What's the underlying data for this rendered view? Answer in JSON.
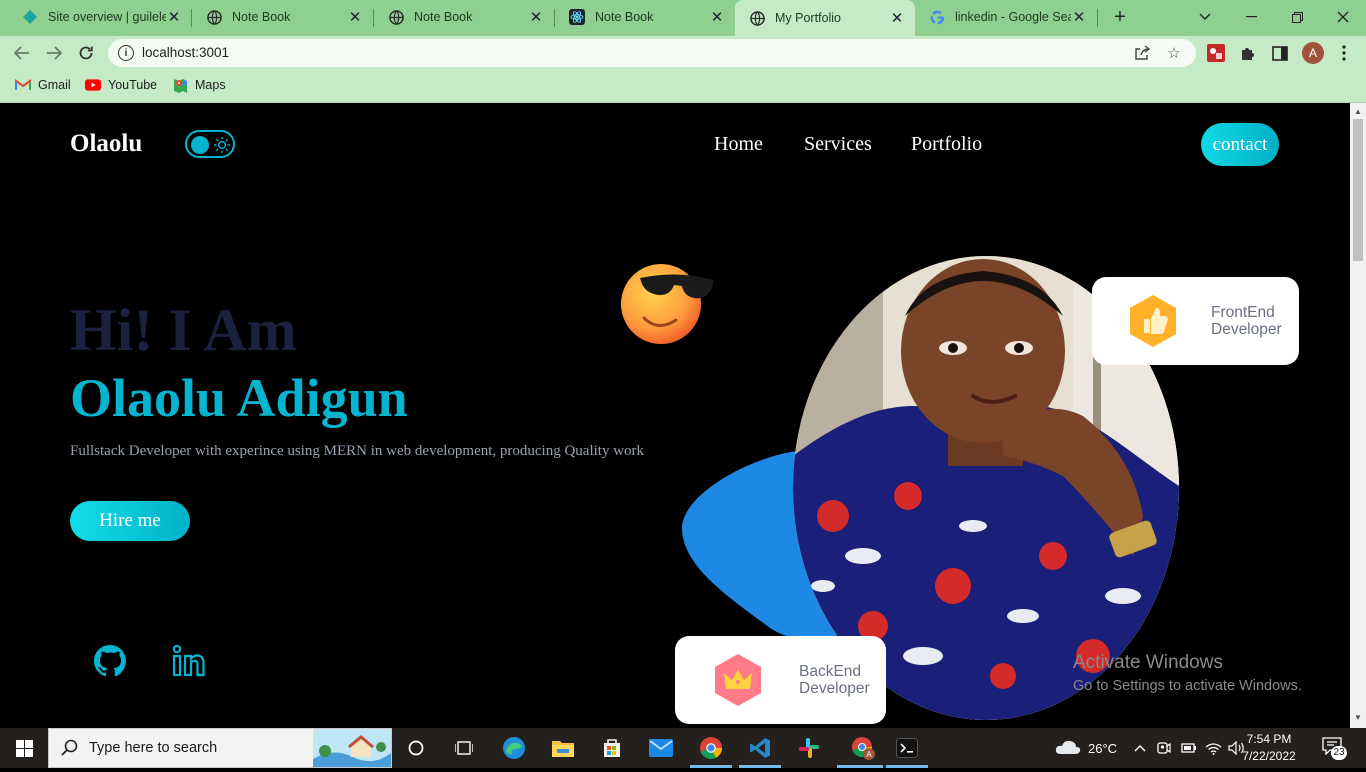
{
  "browser": {
    "tabs": [
      {
        "title": "Site overview | guilele",
        "icon": "netlify-diamond-icon"
      },
      {
        "title": "Note Book",
        "icon": "globe-icon"
      },
      {
        "title": "Note Book",
        "icon": "globe-icon"
      },
      {
        "title": "Note Book",
        "icon": "react-icon"
      },
      {
        "title": "My Portfolio",
        "icon": "globe-icon",
        "active": true
      },
      {
        "title": "linkedin - Google Sea",
        "icon": "google-g-icon"
      }
    ],
    "url": "localhost:3001",
    "bookmarks": [
      {
        "label": "Gmail",
        "icon": "gmail-icon"
      },
      {
        "label": "YouTube",
        "icon": "youtube-icon"
      },
      {
        "label": "Maps",
        "icon": "maps-icon"
      }
    ],
    "profile_initial": "A"
  },
  "site": {
    "logo": "Olaolu",
    "nav": [
      "Home",
      "Services",
      "Portfolio"
    ],
    "contact_label": "contact",
    "greeting": "Hi! I Am",
    "name": "Olaolu Adigun",
    "description": "Fullstack Developer with experince using MERN in web development, producing Quality work",
    "hire_label": "Hire me",
    "card_frontend": {
      "line1": "FrontEnd",
      "line2": "Developer"
    },
    "card_backend": {
      "line1": "BackEnd",
      "line2": "Developer"
    },
    "accent_color": "#07b4cf"
  },
  "watermark": {
    "line1": "Activate Windows",
    "line2": "Go to Settings to activate Windows."
  },
  "taskbar": {
    "search_placeholder": "Type here to search",
    "weather": "26°C",
    "time": "7:54 PM",
    "date": "7/22/2022",
    "notifications": "23"
  }
}
